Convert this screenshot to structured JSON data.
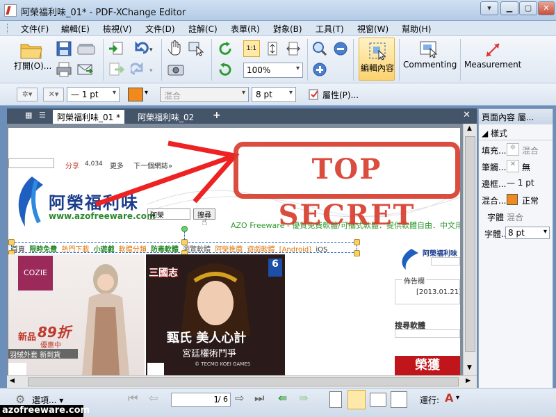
{
  "window": {
    "title": "阿榮福利味_01* - PDF-XChange Editor",
    "colors": {
      "title_bg": "#b4cbe6",
      "accent": "#e5b43c",
      "stamp_red": "#d63a2a"
    }
  },
  "menu": [
    "文件(F)",
    "編輯(E)",
    "檢視(V)",
    "文件(D)",
    "註解(C)",
    "表單(R)",
    "對象(B)",
    "工具(T)",
    "視窗(W)",
    "幫助(H)"
  ],
  "toolbar": {
    "open_label": "打開(O)...",
    "zoom_value": "100%",
    "edit_content_label": "編輯內容",
    "commenting_label": "Commenting",
    "measurement_label": "Measurement"
  },
  "props": {
    "line_width": "1 pt",
    "blend": "混合",
    "font_size": "8 pt",
    "properties_label": "屬性(P)..."
  },
  "tabs": [
    {
      "label": "阿榮福利味_01 *",
      "close": "×"
    },
    {
      "label": "阿榮福利味_02",
      "close": ""
    }
  ],
  "tab_add": "+",
  "tab_close_all": "✕",
  "page": {
    "share": "分享",
    "share_count": "4,034",
    "more": "更多",
    "next_blog": "下一個網誌»",
    "stamp": "TOP SECRET",
    "logo_name": "阿榮福利味",
    "logo_url": "www.azofreeware.com",
    "search_value": "阿榮",
    "search_btn": "搜尋",
    "tagline": "AZO Freeware - 優質免費軟體/可攜式軟體．提供軟體自由．中文用戶",
    "nav": [
      "首頁",
      "限時免費",
      "熱門下載",
      "小遊戲",
      "軟體分類",
      "防毒軟體",
      "瀏覽軟體",
      "阿榮推薦",
      "遊戲軟體",
      "[Android]",
      "iOS"
    ],
    "ad1_brand": "COZIE",
    "ad1_sale": "新品",
    "ad1_discount": "89折",
    "ad1_sub": "優惠中",
    "ad1_line": "羽絨外套 新到貨",
    "ad2_game": "三國志",
    "ad2_title": "甄氏 美人心計",
    "ad2_sub": "宮廷權術鬥爭",
    "ad2_footer": "© TECMO KOEI GAMES",
    "ad2_badge": "6",
    "side_logo": "阿榮福利味",
    "side_notice": "佈告欄",
    "side_date": "[2013.01.21]",
    "side_search": "搜尋軟體",
    "side_banner": "榮獲"
  },
  "panel": {
    "header": "頁面內容 屬...",
    "section": "樣式",
    "rows": [
      {
        "key": "填充...",
        "value": "混合"
      },
      {
        "key": "筆觸...",
        "value": "無"
      },
      {
        "key": "邊框...",
        "value": "1 pt"
      },
      {
        "key": "混合...",
        "value": "正常"
      },
      {
        "key": "字體",
        "value": "混合"
      },
      {
        "key": "字體...",
        "value": "8 pt"
      }
    ]
  },
  "status": {
    "options_label": "選項...",
    "page_current": "1",
    "page_total": "/ 6",
    "run_label": "運行:"
  },
  "watermark": "azofreeware.com"
}
